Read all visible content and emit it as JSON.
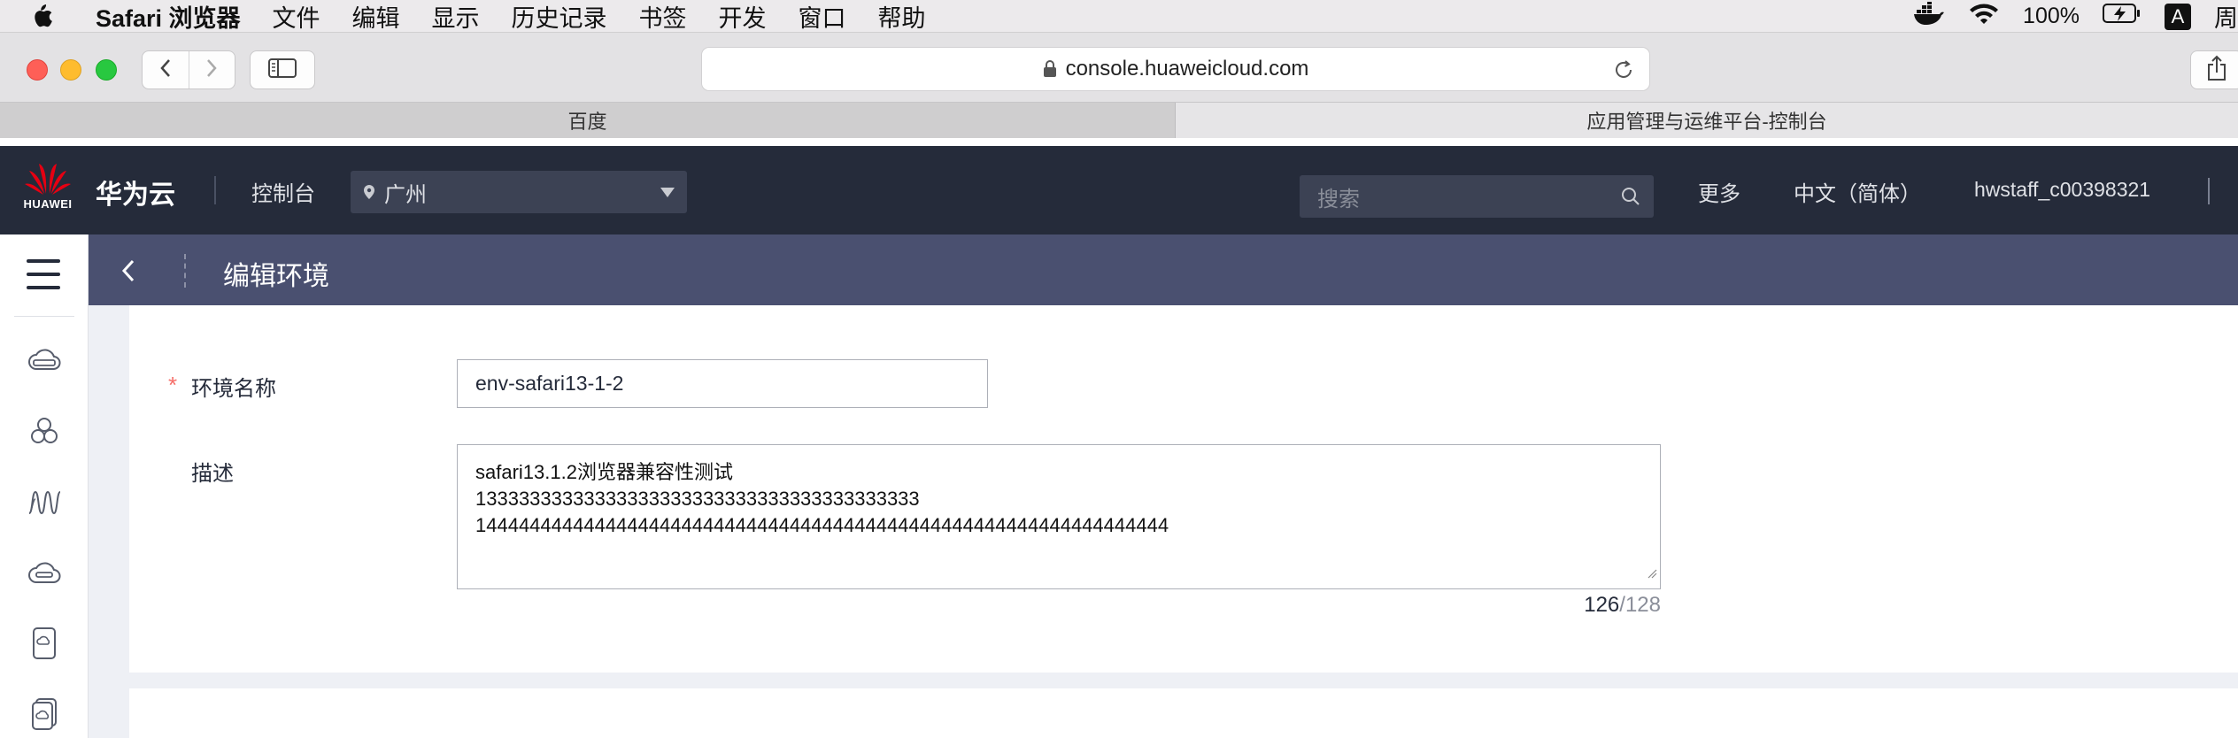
{
  "menubar": {
    "app_name": "Safari 浏览器",
    "items": [
      "文件",
      "编辑",
      "显示",
      "历史记录",
      "书签",
      "开发",
      "窗口",
      "帮助"
    ],
    "battery_percent": "100%",
    "input_method": "A",
    "clock_partial": "周"
  },
  "browser": {
    "url": "console.huaweicloud.com",
    "tabs": [
      {
        "label": "百度",
        "active": false
      },
      {
        "label": "应用管理与运维平台-控制台",
        "active": true
      }
    ]
  },
  "header": {
    "logo_caption": "HUAWEI",
    "brand": "华为云",
    "console": "控制台",
    "region": "广州",
    "search_placeholder": "搜索",
    "more": "更多",
    "language": "中文（简体）",
    "user": "hwstaff_c00398321"
  },
  "sidebar": {
    "icons": [
      "cloud-server-icon",
      "cluster-icon",
      "monitor-wave-icon",
      "cloud-storage-icon",
      "device-cloud-icon",
      "device-stack-icon"
    ]
  },
  "page": {
    "title": "编辑环境"
  },
  "form": {
    "required_mark": "*",
    "name_label": "环境名称",
    "name_value": "env-safari13-1-2",
    "desc_label": "描述",
    "desc_lines": [
      "safari13.1.2浏览器兼容性测试",
      "13333333333333333333333333333333333333333",
      "1444444444444444444444444444444444444444444444444444444444444444"
    ],
    "char_count": "126",
    "char_max": "/128"
  },
  "colors": {
    "header_bg": "#252b3a",
    "titlebar_bg": "#4a5070",
    "required": "#f66f6a",
    "huawei_red": "#e60012"
  }
}
